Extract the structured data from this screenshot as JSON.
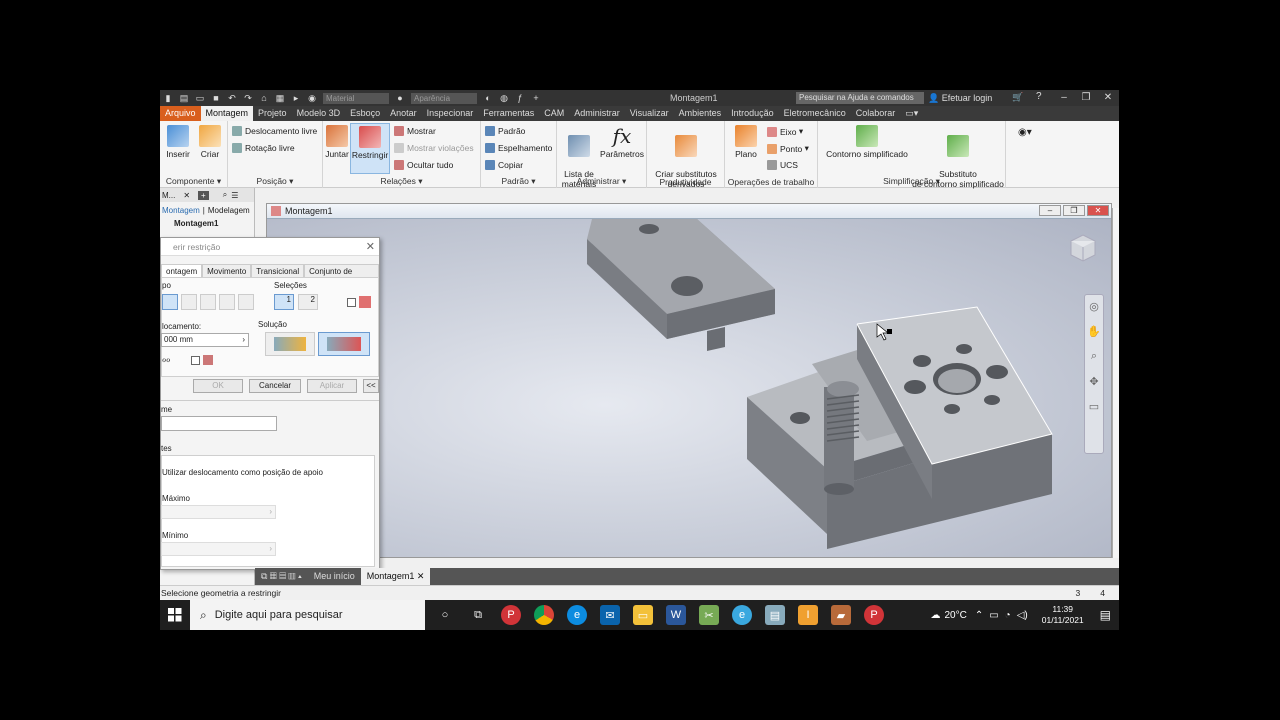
{
  "titlebar": {
    "title": "Montagem1",
    "material_placeholder": "Material",
    "appearance_placeholder": "Aparência",
    "help_search": "Pesquisar na Ajuda e comandos",
    "login": "Efetuar login"
  },
  "ribbon_tabs": [
    "Arquivo",
    "Montagem",
    "Projeto",
    "Modelo 3D",
    "Esboço",
    "Anotar",
    "Inspecionar",
    "Ferramentas",
    "CAM",
    "Administrar",
    "Visualizar",
    "Ambientes",
    "Introdução",
    "Eletromecânico",
    "Colaborar"
  ],
  "ribbon": {
    "componente": {
      "label": "Componente",
      "inserir": "Inserir",
      "criar": "Criar"
    },
    "posicao": {
      "label": "Posição",
      "livre": "Deslocamento livre",
      "rotacao": "Rotação livre"
    },
    "relacoes": {
      "label": "Relações",
      "juntar": "Juntar",
      "restringir": "Restringir",
      "mostrar": "Mostrar",
      "violacoes": "Mostrar violações",
      "ocultar": "Ocultar tudo"
    },
    "padrao": {
      "label": "Padrão",
      "padrao": "Padrão",
      "espelhamento": "Espelhamento",
      "copiar": "Copiar"
    },
    "administrar": {
      "label": "Administrar",
      "lista": "Lista de\nmateriais",
      "parametros": "Parâmetros"
    },
    "produtividade": {
      "label": "Produtividade",
      "criar_sub": "Criar substitutos\nderivados"
    },
    "operacoes": {
      "label": "Operações de trabalho",
      "plano": "Plano",
      "eixo": "Eixo",
      "ponto": "Ponto",
      "ucs": "UCS"
    },
    "simplificacao": {
      "label": "Simplificação",
      "contorno": "Contorno simplificado",
      "substituto": "Substituto\nde contorno simplificado"
    }
  },
  "browser": {
    "tab": "M...",
    "montagem": "Montagem",
    "modelagem": "Modelagem",
    "root": "Montagem1"
  },
  "dialog": {
    "title": "erir restrição",
    "tabs": [
      "ontagem",
      "Movimento",
      "Transicional",
      "Conjunto de restrições"
    ],
    "tipo": "po",
    "selecoes": "Seleções",
    "deslocamento": "locamento:",
    "deslocamento_value": "000 mm",
    "solucao": "Solução",
    "ok": "OK",
    "cancelar": "Cancelar",
    "aplicar": "Aplicar",
    "expand": "<<",
    "nome": "me",
    "limites": "tes",
    "usar_desl": "Utilizar deslocamento como posição de apoio",
    "maximo": "Máximo",
    "minimo": "Mínimo",
    "sel1": "1",
    "sel2": "2"
  },
  "graphics": {
    "title": "Montagem1"
  },
  "doctabs": {
    "home": "Meu início",
    "doc": "Montagem1"
  },
  "status": {
    "text": "Selecione geometria a restringir",
    "n1": "3",
    "n2": "4"
  },
  "taskbar": {
    "search": "Digite aqui para pesquisar",
    "temp": "20°C",
    "time": "11:39",
    "date": "01/11/2021"
  }
}
